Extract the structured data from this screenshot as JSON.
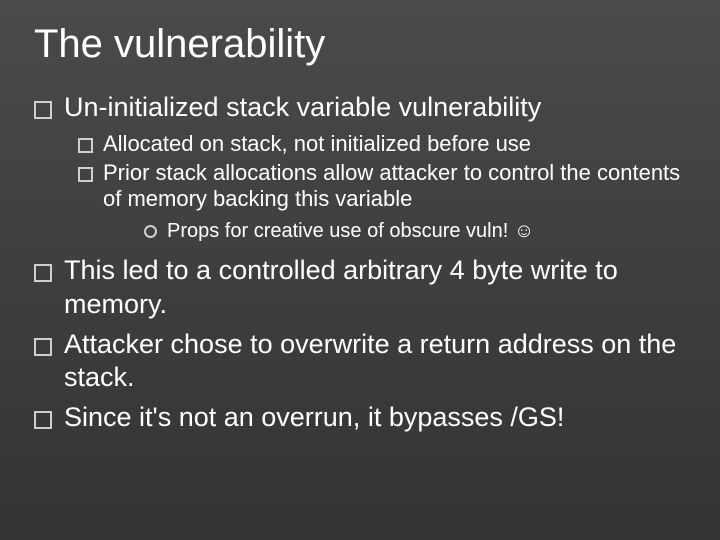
{
  "slide": {
    "title": "The vulnerability",
    "bullets": {
      "b1": "Un-initialized stack variable vulnerability",
      "b1a": "Allocated on stack, not initialized before use",
      "b1b": "Prior stack allocations allow attacker to control the contents of memory backing this variable",
      "b1b_i": "Props for creative use of obscure vuln! ☺",
      "b2": "This led to a controlled arbitrary 4 byte write to memory.",
      "b3": "Attacker chose to overwrite a return address on the stack.",
      "b4": "Since it's not an overrun, it bypasses /GS!"
    }
  }
}
